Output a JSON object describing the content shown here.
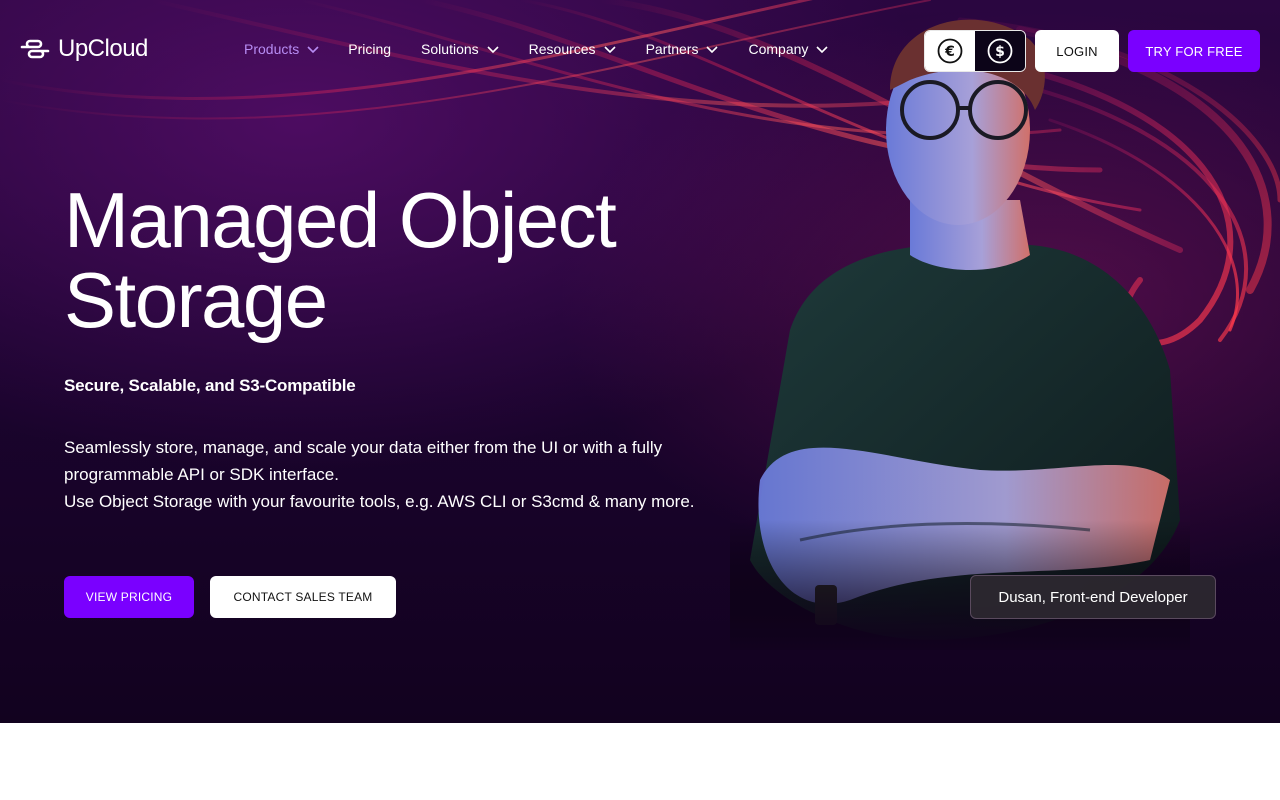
{
  "brand": {
    "name": "UpCloud"
  },
  "nav": {
    "items": [
      {
        "label": "Products",
        "has_dropdown": true,
        "active": true
      },
      {
        "label": "Pricing",
        "has_dropdown": false
      },
      {
        "label": "Solutions",
        "has_dropdown": true
      },
      {
        "label": "Resources",
        "has_dropdown": true
      },
      {
        "label": "Partners",
        "has_dropdown": true
      },
      {
        "label": "Company",
        "has_dropdown": true
      }
    ],
    "currency": {
      "options": [
        "€",
        "$"
      ],
      "selected": "$"
    },
    "login_label": "LOGIN",
    "try_label": "TRY FOR FREE"
  },
  "hero": {
    "title_line1": "Managed Object",
    "title_line2": "Storage",
    "subtitle": "Secure, Scalable, and S3-Compatible",
    "description_line1": "Seamlessly store, manage, and scale your data either from the UI or with a fully programmable API or SDK interface.",
    "description_line2": "Use Object Storage with your favourite tools, e.g. AWS CLI or S3cmd & many more.",
    "primary_cta": "VIEW PRICING",
    "secondary_cta": "CONTACT SALES TEAM",
    "person_caption": "Dusan, Front-end Developer"
  },
  "colors": {
    "accent": "#7a00ff",
    "nav_active": "#b78cf3",
    "hero_bg": "#1c0430",
    "streak": "#ff3050"
  }
}
